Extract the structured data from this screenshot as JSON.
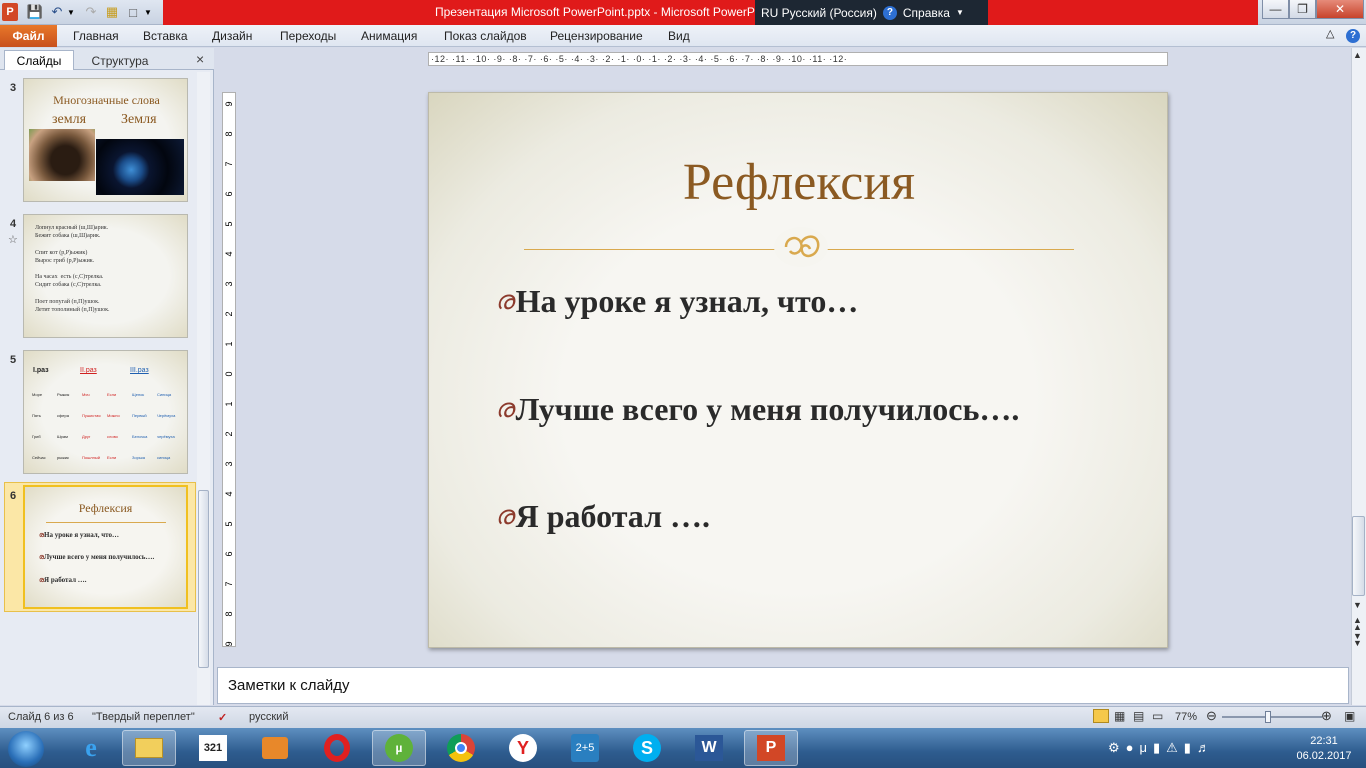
{
  "window": {
    "title": "Презентация Microsoft PowerPoint.pptx - Microsoft PowerP",
    "lang": "RU Русский (Россия)",
    "help": "Справка",
    "help_q": "?"
  },
  "menu": {
    "file": "Файл",
    "items": [
      "Главная",
      "Вставка",
      "Дизайн",
      "Переходы",
      "Анимация",
      "Показ слайдов",
      "Рецензирование",
      "Вид"
    ]
  },
  "panel": {
    "tabs": [
      "Слайды",
      "Структура"
    ],
    "close": "×"
  },
  "thumbnails": {
    "s3": {
      "num": "3",
      "title": "Многозначные слова",
      "left": "земля",
      "right": "Земля"
    },
    "s4": {
      "num": "4",
      "lines": [
        "Лопнул красный (ш,Ш)арик.",
        "Бежит собака (ш,Ш)арик.",
        "",
        "Спит кот (р,Р)ыжик)",
        "Вырос гриб (р,Р)ыжик.",
        "",
        "На часах  есть (с,С)трелка.",
        "Сидит собака (с,С)трелка.",
        "",
        "Поет попугай (п,П)ушок.",
        "Летит тополиный (п,П)ушок."
      ]
    },
    "s5": {
      "num": "5",
      "headers": [
        "I.раз",
        "II.раз",
        "III.раз"
      ],
      "rows": [
        [
          "Море",
          "Рыжик",
          "Мяч",
          "Если",
          "Щенок",
          "Синица"
        ],
        [
          "Пять",
          "сфера",
          "Пушистая",
          "Можно",
          "Первый",
          "Черёмуха"
        ],
        [
          "Гриб",
          "Шрам",
          "Друг",
          "слово",
          "Белочка",
          "черёмуха"
        ],
        [
          "Сейчас",
          "рыжик",
          "Пошлный",
          "Если",
          "Зорька",
          "синица"
        ]
      ]
    },
    "s6": {
      "num": "6",
      "title": "Рефлексия",
      "lines": [
        "На уроке я узнал, что…",
        "Лучше всего у меня получилось….",
        "Я работал  …."
      ]
    }
  },
  "ruler": {
    "horizontal": "·12· ·11· ·10· ·9· ·8· ·7· ·6· ·5· ·4· ·3· ·2· ·1· ·0· ·1· ·2· ·3· ·4· ·5· ·6· ·7· ·8· ·9· ·10· ·11· ·12·",
    "vertical": [
      "9",
      "8",
      "7",
      "6",
      "5",
      "4",
      "3",
      "2",
      "1",
      "0",
      "1",
      "2",
      "3",
      "4",
      "5",
      "6",
      "7",
      "8",
      "9"
    ]
  },
  "slide": {
    "title": "Рефлексия",
    "bullets": [
      "На уроке я узнал, что…",
      "Лучше всего у меня получилось….",
      "Я работал …."
    ],
    "bullet_glyph": "ര"
  },
  "notes": {
    "placeholder": "Заметки к слайду"
  },
  "status": {
    "slide": "Слайд 6 из 6",
    "theme": "\"Твердый переплет\"",
    "language": "русский",
    "zoom": "77%",
    "zoom_fraction": 0.46
  },
  "tray": {
    "time": "22:31",
    "date": "06.02.2017"
  },
  "colors": {
    "accent_title": "#8b5a22",
    "file_tab": "#d8611f",
    "title_red": "#e01a1a"
  }
}
